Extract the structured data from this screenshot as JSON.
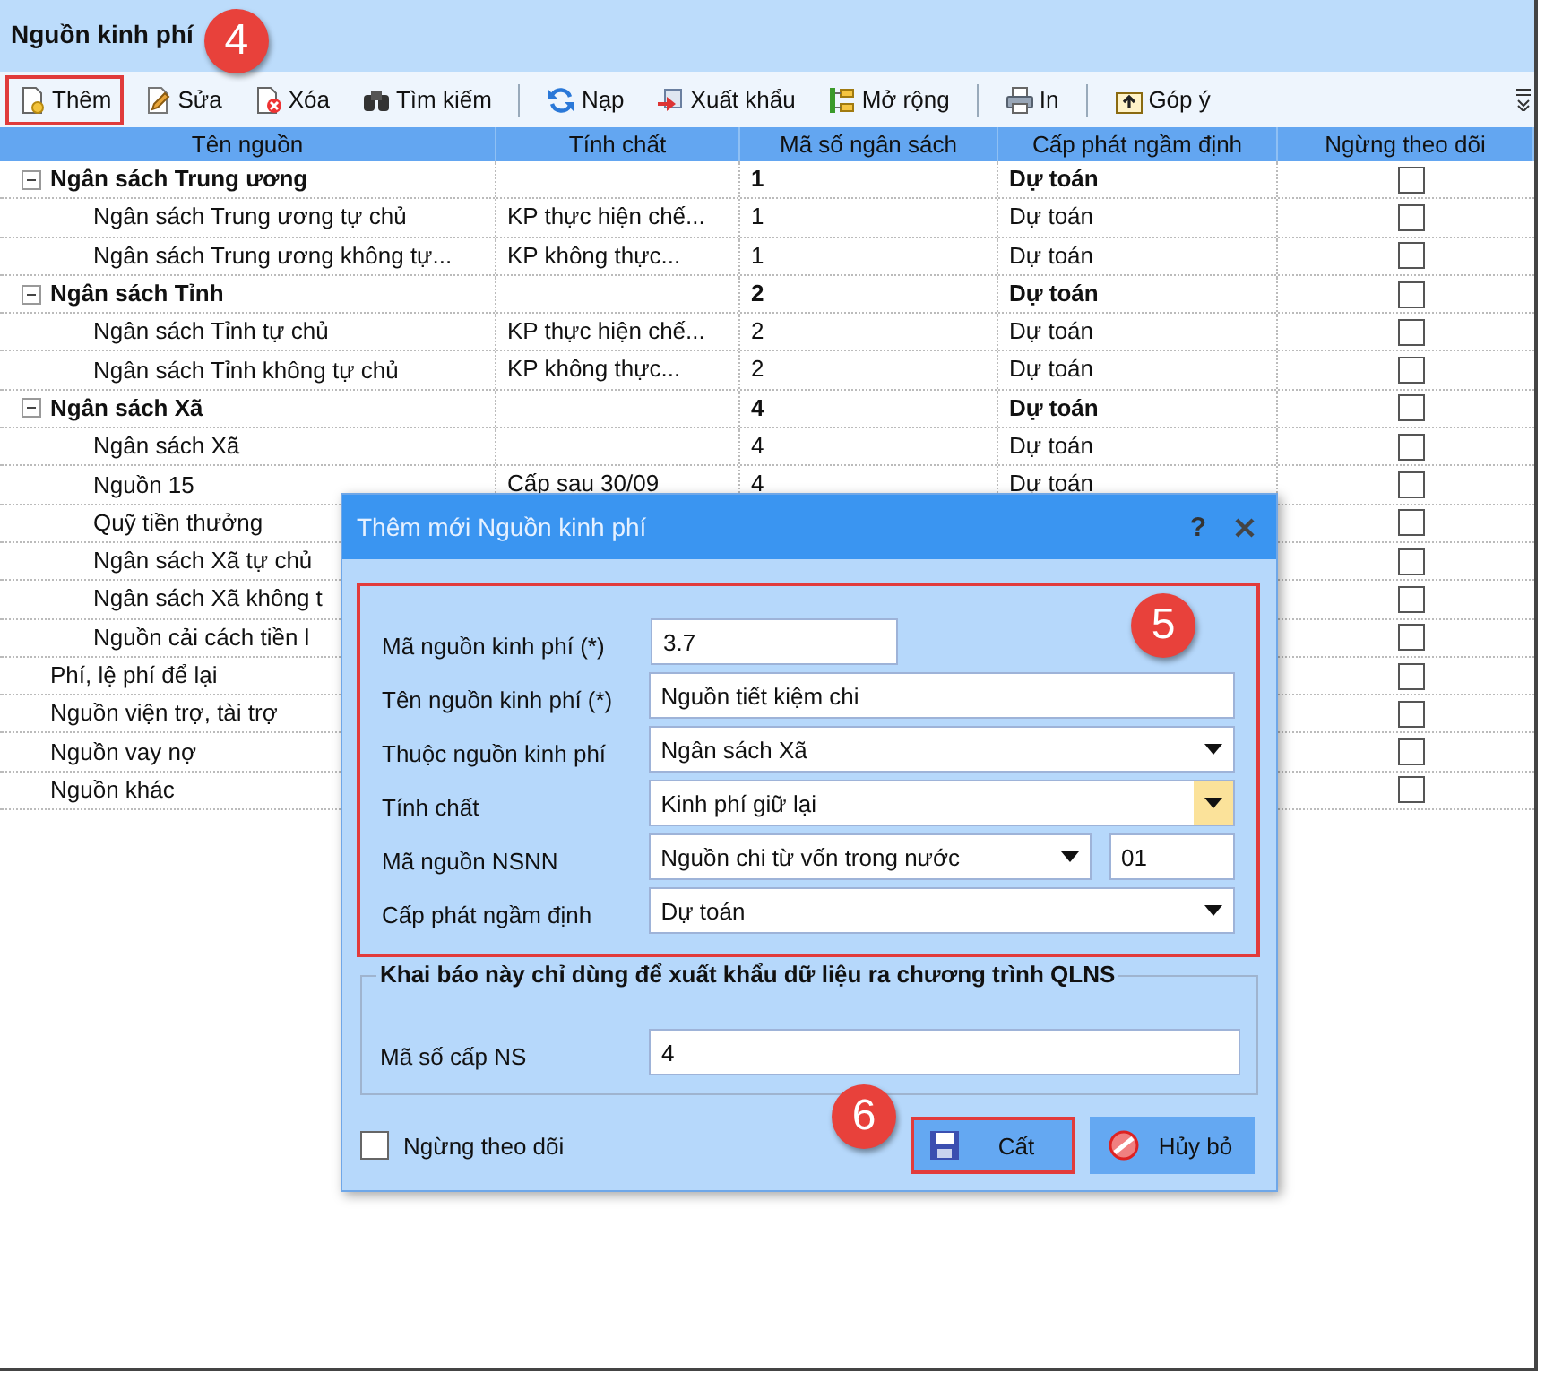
{
  "window": {
    "title": "Nguồn kinh phí"
  },
  "toolbar": [
    {
      "kind": "button",
      "label": "Thêm",
      "highlighted": true,
      "callout": "4"
    },
    {
      "kind": "button",
      "label": "Sửa"
    },
    {
      "kind": "button",
      "label": "Xóa"
    },
    {
      "kind": "button",
      "label": "Tìm kiếm"
    },
    {
      "kind": "separator"
    },
    {
      "kind": "button",
      "label": "Nạp"
    },
    {
      "kind": "button",
      "label": "Xuất khẩu"
    },
    {
      "kind": "button",
      "label": "Mở rộng"
    },
    {
      "kind": "separator"
    },
    {
      "kind": "button",
      "label": "In"
    },
    {
      "kind": "separator"
    },
    {
      "kind": "button",
      "label": "Góp ý"
    }
  ],
  "table": {
    "columns": [
      "Tên nguồn",
      "Tính chất",
      "Mã số ngân sách",
      "Cấp phát ngầm định",
      "Ngừng theo dõi"
    ],
    "rows": [
      {
        "name": "Ngân sách Trung ương",
        "code": "1",
        "allocation": "Dự toán",
        "checked": false,
        "expanded": true,
        "children": [
          {
            "name": "Ngân sách Trung ương tự chủ",
            "nature": "KP thực hiện chế...",
            "code": "1",
            "allocation": "Dự toán",
            "checked": false
          },
          {
            "name": "Ngân sách Trung ương không tự...",
            "nature": "KP không thực...",
            "code": "1",
            "allocation": "Dự toán",
            "checked": false
          }
        ]
      },
      {
        "name": "Ngân sách Tỉnh",
        "code": "2",
        "allocation": "Dự toán",
        "checked": false,
        "expanded": true,
        "children": [
          {
            "name": "Ngân sách Tỉnh tự chủ",
            "nature": "KP thực hiện chế...",
            "code": "2",
            "allocation": "Dự toán",
            "checked": false
          },
          {
            "name": "Ngân sách Tỉnh không tự chủ",
            "nature": "KP không thực...",
            "code": "2",
            "allocation": "Dự toán",
            "checked": false
          }
        ]
      },
      {
        "name": "Ngân sách Xã",
        "code": "4",
        "allocation": "Dự toán",
        "checked": false,
        "expanded": true,
        "children": [
          {
            "name": "Ngân sách Xã",
            "code": "4",
            "allocation": "Dự toán",
            "checked": false
          },
          {
            "name": "Nguồn 15",
            "nature": "Cấp sau 30/09",
            "code": "4",
            "allocation": "Dự toán",
            "checked": false
          },
          {
            "name": "Quỹ tiền thưởng",
            "checked": false
          },
          {
            "name": "Ngân sách Xã tự chủ",
            "checked": false
          },
          {
            "name": "Ngân sách Xã không t",
            "checked": false
          },
          {
            "name": "Nguồn cải cách tiền l",
            "checked": false
          }
        ]
      },
      {
        "name": "Phí, lệ phí để lại",
        "checked": false
      },
      {
        "name": "Nguồn viện trợ, tài trợ",
        "checked": false
      },
      {
        "name": "Nguồn vay nợ",
        "checked": false
      },
      {
        "name": "Nguồn khác",
        "checked": false
      }
    ]
  },
  "dialog": {
    "title": "Thêm mới Nguồn kinh phí",
    "help": "?",
    "panel": {
      "callout": "5",
      "fields": [
        {
          "kind": "short",
          "label": "Mã nguồn kinh phí (*)",
          "value": "3.7"
        },
        {
          "kind": "text",
          "label": "Tên nguồn kinh phí (*)",
          "value": "Nguồn tiết kiệm chi"
        },
        {
          "kind": "dropdown",
          "label": "Thuộc nguồn kinh phí",
          "value": "Ngân sách Xã"
        },
        {
          "kind": "dropdown",
          "label": "Tính chất",
          "value": "Kinh phí giữ lại",
          "focused": true
        },
        {
          "kind": "dropdown-code",
          "label": "Mã nguồn NSNN",
          "value": "Nguồn chi từ vốn trong nước",
          "code": "01"
        },
        {
          "kind": "dropdown",
          "label": "Cấp phát ngầm định",
          "value": "Dự toán"
        }
      ]
    },
    "group": {
      "legend": "Khai báo này chỉ dùng để xuất khẩu dữ liệu ra chương trình QLNS",
      "fields": [
        {
          "label": "Mã số cấp NS",
          "value": "4"
        }
      ]
    },
    "checkbox": {
      "label": "Ngừng theo dõi",
      "checked": false
    },
    "buttons": [
      {
        "label": "Cất",
        "highlighted": true,
        "callout": "6"
      },
      {
        "label": "Hủy bỏ"
      }
    ]
  }
}
